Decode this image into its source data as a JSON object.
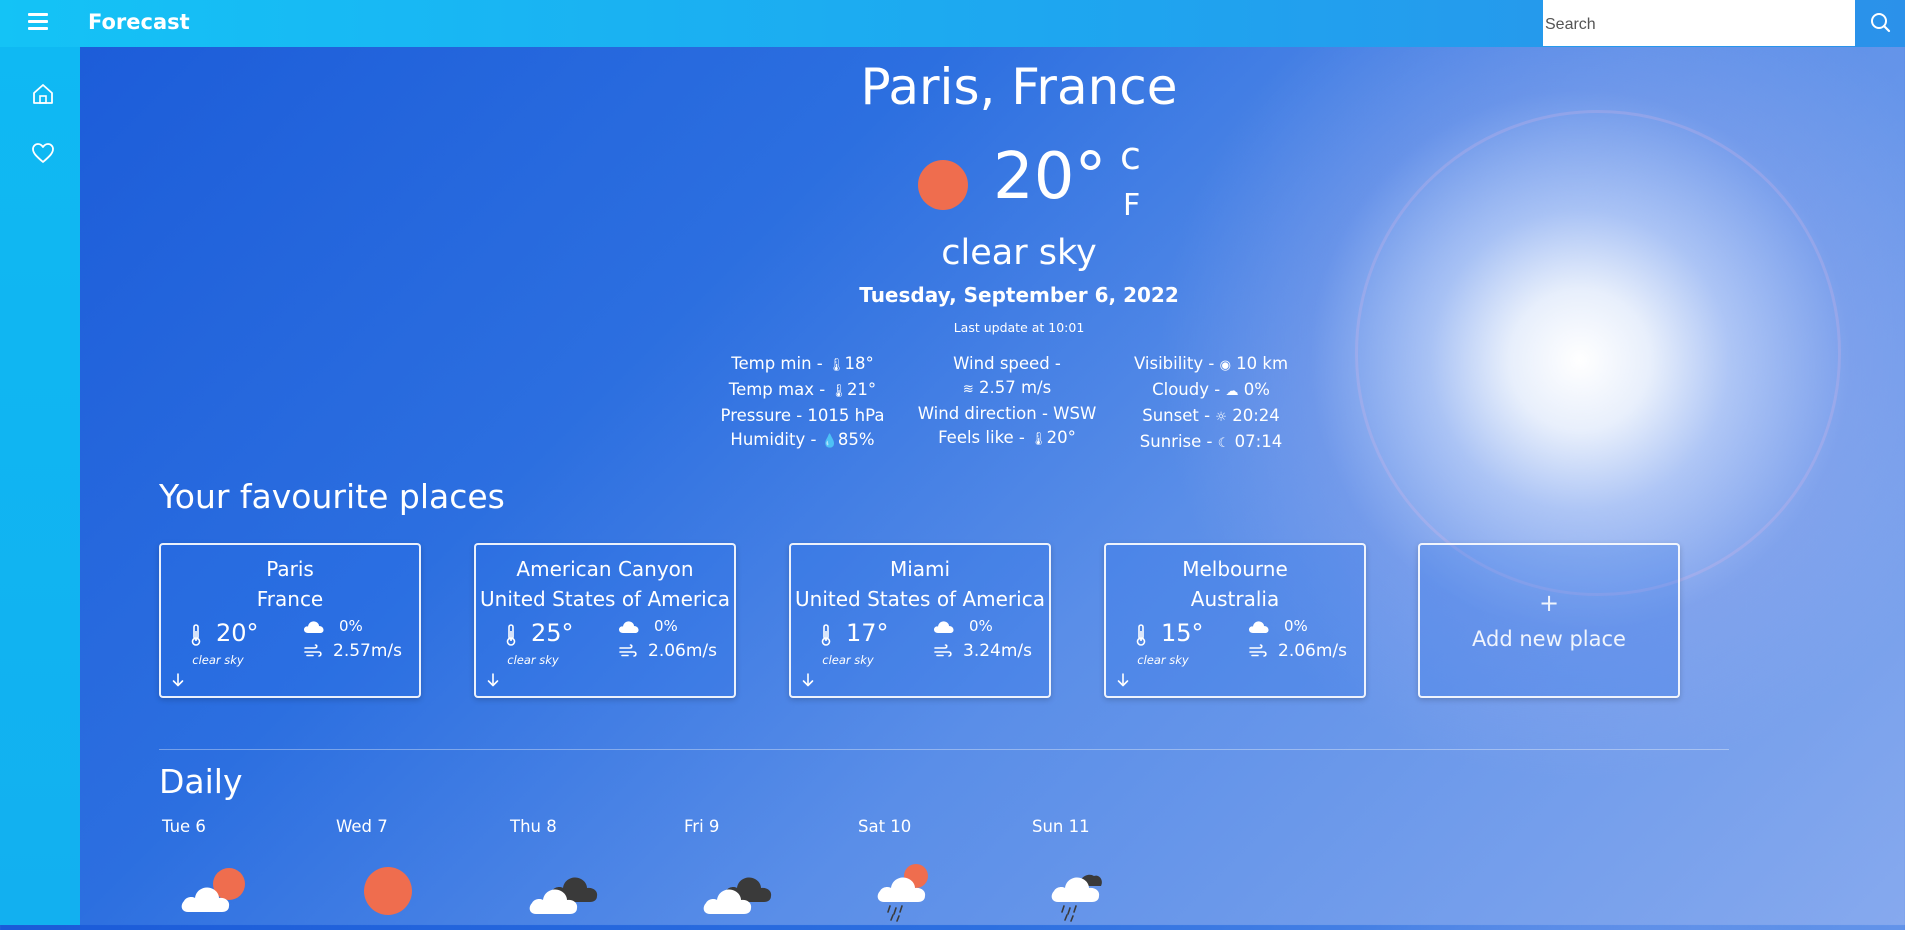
{
  "app": {
    "title": "Forecast"
  },
  "search": {
    "placeholder": "Search"
  },
  "current": {
    "city": "Paris, France",
    "temp": "20°",
    "unit_c": "c",
    "unit_f": "F",
    "description": "clear sky",
    "date": "Tuesday, September 6, 2022",
    "last_update": "Last update at 10:01",
    "details": {
      "col1": [
        {
          "label": "Temp min - ",
          "value": "18°",
          "icon": "thermometer-icon"
        },
        {
          "label": "Temp max - ",
          "value": "21°",
          "icon": "thermometer-icon"
        },
        {
          "label": "Pressure - 1015 hPa",
          "value": "",
          "icon": ""
        },
        {
          "label": "Humidity - ",
          "value": "85%",
          "icon": "droplet-icon"
        }
      ],
      "col2": [
        {
          "label": "Wind speed -",
          "value": "",
          "icon": ""
        },
        {
          "label": "",
          "value": "2.57 m/s",
          "icon": "wind-icon"
        },
        {
          "label": "Wind direction - WSW",
          "value": "",
          "icon": ""
        },
        {
          "label": "Feels like - ",
          "value": "20°",
          "icon": "thermometer-icon"
        }
      ],
      "col3": [
        {
          "label": "Visibility - ",
          "value": "10 km",
          "icon": "eye-icon"
        },
        {
          "label": "Cloudy - ",
          "value": "0%",
          "icon": "cloud-icon"
        },
        {
          "label": "Sunset - ",
          "value": "20:24",
          "icon": "sun-icon"
        },
        {
          "label": "Sunrise - ",
          "value": "07:14",
          "icon": "moon-icon"
        }
      ]
    }
  },
  "favourites": {
    "title": "Your favourite places",
    "places": [
      {
        "city": "Paris",
        "country": "France",
        "temp": "20°",
        "desc": "clear sky",
        "cloud": "0%",
        "wind": "2.57m/s"
      },
      {
        "city": "American Canyon",
        "country": "United States of America",
        "temp": "25°",
        "desc": "clear sky",
        "cloud": "0%",
        "wind": "2.06m/s"
      },
      {
        "city": "Miami",
        "country": "United States of America",
        "temp": "17°",
        "desc": "clear sky",
        "cloud": "0%",
        "wind": "3.24m/s"
      },
      {
        "city": "Melbourne",
        "country": "Australia",
        "temp": "15°",
        "desc": "clear sky",
        "cloud": "0%",
        "wind": "2.06m/s"
      }
    ],
    "add_plus": "+",
    "add_label": "Add new place"
  },
  "daily": {
    "title": "Daily",
    "days": [
      {
        "label": "Tue 6",
        "icon": "partly-cloudy-sun-icon"
      },
      {
        "label": "Wed 7",
        "icon": "sun-icon"
      },
      {
        "label": "Thu 8",
        "icon": "cloudy-icon"
      },
      {
        "label": "Fri 9",
        "icon": "cloudy-icon"
      },
      {
        "label": "Sat 10",
        "icon": "rain-sun-icon"
      },
      {
        "label": "Sun 11",
        "icon": "rain-cloud-icon"
      }
    ]
  },
  "colors": {
    "sun": "#ef6d4e",
    "topbar": "#14c3f6",
    "sidebar": "#0fb9f3"
  }
}
